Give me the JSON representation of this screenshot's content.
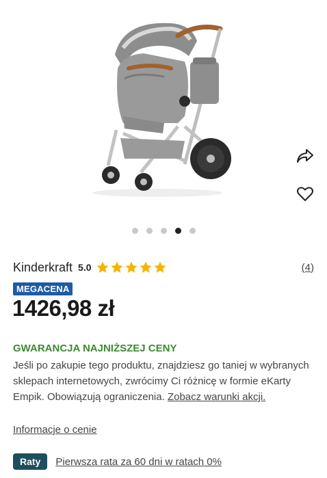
{
  "gallery": {
    "image_alt": "product-photo-stroller",
    "dots_count": 5,
    "active_dot": 4
  },
  "actions": {
    "share_icon": "share-icon",
    "wishlist_icon": "heart-icon"
  },
  "product": {
    "brand": "Kinderkraft",
    "rating": "5.0",
    "stars": 5,
    "reviews": "(4)",
    "badge": "MEGACENA",
    "price": "1426,98 zł"
  },
  "guarantee": {
    "title": "GWARANCJA NAJNIŻSZEJ CENY",
    "text": "Jeśli po zakupie tego produktu, znajdziesz go taniej w wybranych sklepach internetowych, zwrócimy Ci różnicę w formie eKarty Empik. Obowiązują ograniczenia.",
    "link": "Zobacz warunki akcji."
  },
  "price_info_link": "Informacje o cenie",
  "installments": {
    "badge": "Raty",
    "text": "Pierwsza rata za 60 dni w ratach 0%"
  },
  "colors": {
    "star": "#f5b400",
    "megacena_badge": "#1f5aa6",
    "guarantee_green": "#3b8a2e",
    "raty_badge": "#1f4e5e"
  }
}
